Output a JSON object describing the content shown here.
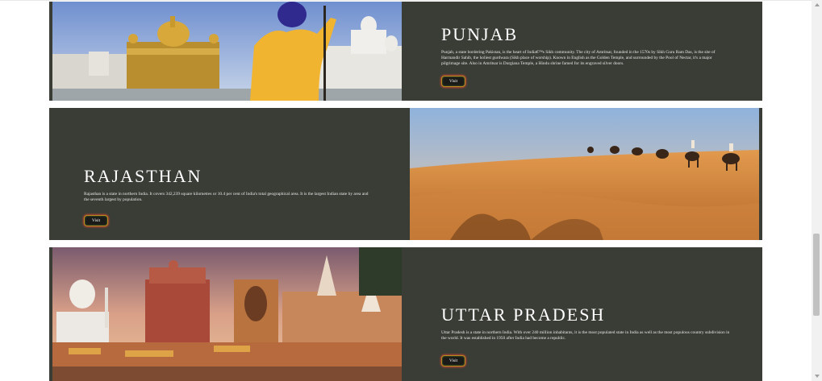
{
  "states": [
    {
      "title": "PUNJAB",
      "description": "Punjab, a state bordering Pakistan, is the heart of India€™s Sikh community. The city of Amritsar, founded in the 1570s by Sikh Guru Ram Das, is the site of Harmandir Sahib, the holiest gurdwara (Sikh place of worship). Known in English as the Golden Temple, and surrounded by the Pool of Nectar, it's a major pilgrimage site. Also in Amritsar is Durgiana Temple, a Hindu shrine famed for its engraved silver doors.",
      "button": "Visit"
    },
    {
      "title": "RAJASTHAN",
      "description": "Rajasthan is a state in northern India. It covers 342,239 square kilometres or 10.4 per cent of India's total geographical area. It is the largest Indian state by area and the seventh largest by population.",
      "button": "Visit"
    },
    {
      "title": "UTTAR PRADESH",
      "description": "Uttar Pradesh is a state in northern India. With over 240 million inhabitants, it is the most populated state in India as well as the most populous country subdivision in the world. It was established in 1950 after India had become a republic.",
      "button": "Visit"
    }
  ],
  "colors": {
    "card_bg": "#393d36",
    "button_border": "#b98a1f",
    "button_glow": "#d6482e"
  }
}
